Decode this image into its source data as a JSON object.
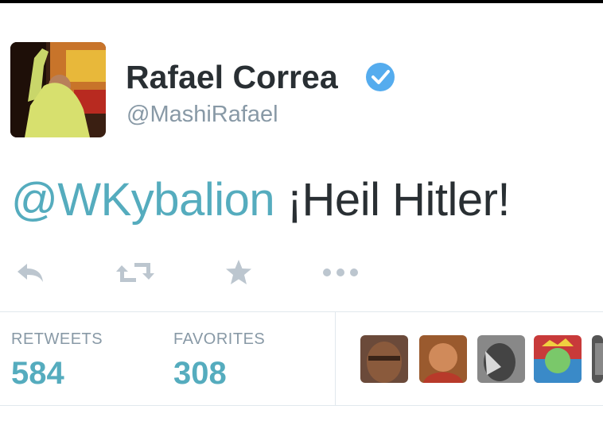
{
  "user": {
    "name": "Rafael Correa",
    "handle": "@MashiRafael",
    "verified": true
  },
  "tweet": {
    "mention": "@WKybalion",
    "text": "¡Heil Hitler!"
  },
  "actions": {
    "reply_icon": "reply-icon",
    "retweet_icon": "retweet-icon",
    "favorite_icon": "star-icon",
    "more_icon": "more-icon"
  },
  "stats": {
    "retweets_label": "RETWEETS",
    "retweets_count": "584",
    "favorites_label": "FAVORITES",
    "favorites_count": "308"
  },
  "colors": {
    "accent": "#55acbe",
    "text": "#292f33",
    "muted": "#8899a6",
    "verified": "#55acee"
  }
}
